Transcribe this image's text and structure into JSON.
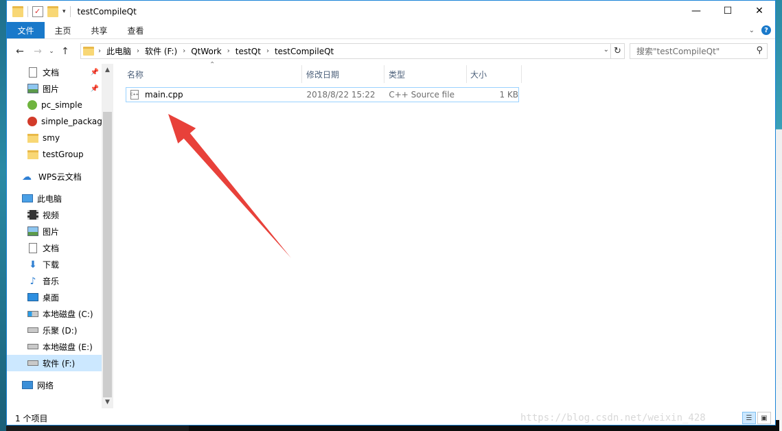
{
  "window": {
    "title": "testCompileQt",
    "controls": {
      "minimize": "—",
      "maximize": "☐",
      "close": "✕"
    }
  },
  "ribbon": {
    "tabs": [
      "文件",
      "主页",
      "共享",
      "查看"
    ],
    "help": "?"
  },
  "address": {
    "crumbs": [
      "此电脑",
      "软件 (F:)",
      "QtWork",
      "testQt",
      "testCompileQt"
    ],
    "search_placeholder": "搜索\"testCompileQt\""
  },
  "nav": {
    "items": [
      {
        "label": "文档",
        "icon": "document-icon",
        "pinned": true
      },
      {
        "label": "图片",
        "icon": "picture-icon",
        "pinned": true
      },
      {
        "label": "pc_simple",
        "icon": "green-badge-icon"
      },
      {
        "label": "simple_packag",
        "icon": "red-badge-icon"
      },
      {
        "label": "smy",
        "icon": "folder-icon"
      },
      {
        "label": "testGroup",
        "icon": "folder-icon"
      },
      {
        "label": "WPS云文档",
        "icon": "cloud-icon"
      },
      {
        "label": "此电脑",
        "icon": "computer-icon"
      },
      {
        "label": "视频",
        "icon": "video-icon"
      },
      {
        "label": "图片",
        "icon": "picture-icon"
      },
      {
        "label": "文档",
        "icon": "document-icon"
      },
      {
        "label": "下载",
        "icon": "download-icon"
      },
      {
        "label": "音乐",
        "icon": "music-icon"
      },
      {
        "label": "桌面",
        "icon": "desktop-icon"
      },
      {
        "label": "本地磁盘 (C:)",
        "icon": "system-drive-icon"
      },
      {
        "label": "乐聚 (D:)",
        "icon": "drive-icon"
      },
      {
        "label": "本地磁盘 (E:)",
        "icon": "drive-icon"
      },
      {
        "label": "软件 (F:)",
        "icon": "drive-icon",
        "selected": true
      },
      {
        "label": "网络",
        "icon": "network-icon"
      }
    ]
  },
  "files": {
    "columns": [
      "名称",
      "修改日期",
      "类型",
      "大小"
    ],
    "rows": [
      {
        "name": "main.cpp",
        "date": "2018/8/22 15:22",
        "type": "C++ Source file",
        "size": "1 KB",
        "icon_text": "C++"
      }
    ]
  },
  "status": {
    "count": "1 个项目",
    "watermark": "https://blog.csdn.net/weixin_428"
  },
  "accent": "#1979ca",
  "annotation_arrow_color": "#e8413a"
}
